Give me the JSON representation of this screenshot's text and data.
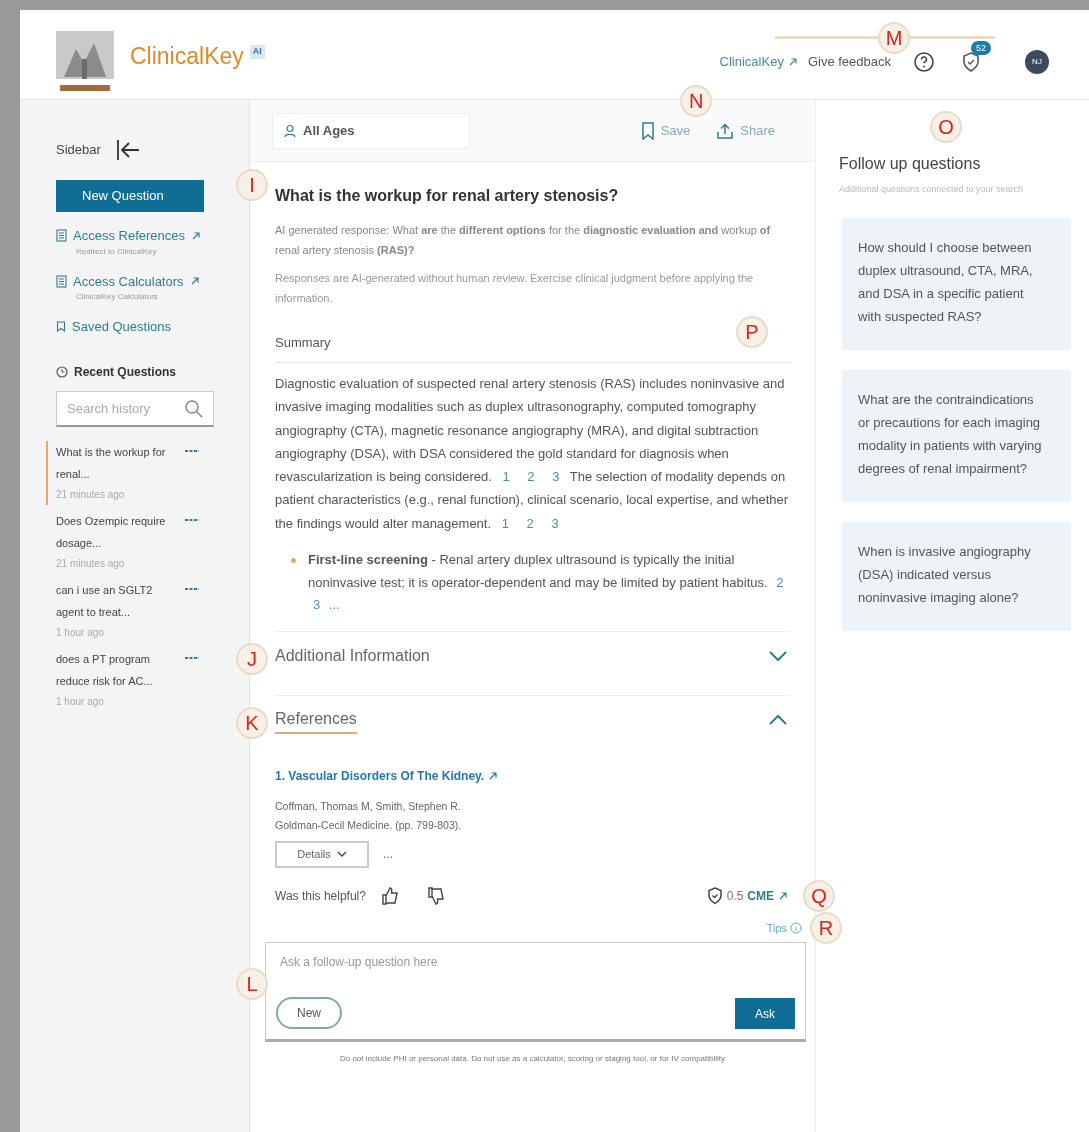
{
  "header": {
    "brand": "ClinicalKey",
    "brand_badge": "AI",
    "links": [
      {
        "label": "ClinicalKey",
        "external": true
      },
      {
        "label": "Give feedback",
        "external": false
      }
    ],
    "notification_count": "52",
    "avatar": "NJ"
  },
  "sidebar": {
    "title": "Sidebar",
    "new_question": "New Question",
    "links": [
      {
        "label": "Access References",
        "sublabel": "Redirect to ClinicalKey",
        "kind": "external"
      },
      {
        "label": "Access Calculators",
        "sublabel": "ClinicalKey Calculators",
        "kind": "external"
      },
      {
        "label": "Saved Questions",
        "kind": "saved"
      }
    ],
    "recent_title": "Recent Questions",
    "search": {
      "placeholder": "Search history"
    },
    "history": [
      {
        "title": "What is the workup for renal...",
        "time": "21 minutes ago",
        "selected": true
      },
      {
        "title": "Does Ozempic require dosage...",
        "time": "21 minutes ago",
        "selected": false
      },
      {
        "title": "can i use an SGLT2 agent to treat...",
        "time": "1 hour ago",
        "selected": false
      },
      {
        "title": "does a PT program reduce risk for AC...",
        "time": "1 hour ago",
        "selected": false
      }
    ]
  },
  "main": {
    "age_filter": "All Ages",
    "actions": [
      {
        "label": "Save",
        "kind": "save"
      },
      {
        "label": "Share",
        "kind": "share"
      }
    ],
    "question": "What is the workup for renal artery stenosis?",
    "ai_response": "AI generated response:  What **are** the **different options** for the **diagnostic evaluation and** workup **of** renal artery stenosis **(RAS)?**",
    "disclaimer": "Responses are AI-generated without human review. Exercise clinical judgment before applying the information.",
    "summary_title": "Summary",
    "summary": [
      {
        "kind": "text",
        "text": "Diagnostic evaluation of suspected renal artery stenosis (RAS) includes noninvasive and invasive imaging modalities such as duplex ultrasonography, computed tomography angiography (CTA), magnetic resonance angiography (MRA), and digital subtraction angiography (DSA), with DSA considered the gold standard for diagnosis when revascularization is being considered."
      },
      {
        "kind": "cite",
        "text": "1"
      },
      {
        "kind": "cite",
        "text": "2"
      },
      {
        "kind": "cite",
        "text": "3"
      },
      {
        "kind": "text",
        "text": "The selection of modality depends on patient characteristics (e.g., renal function), clinical scenario, local expertise, and whether the findings would alter management."
      },
      {
        "kind": "cite",
        "text": "1"
      },
      {
        "kind": "cite",
        "text": "2"
      },
      {
        "kind": "cite",
        "text": "3"
      }
    ],
    "bullets": [
      {
        "text": "**First-line screening** - Renal artery duplex ultrasound is typically the initial noninvasive test; it is operator-dependent and may be limited by patient habitus.",
        "cites": [
          "2",
          "3"
        ],
        "more": "..."
      }
    ],
    "sections": [
      {
        "title": "Additional Information",
        "expanded": false
      },
      {
        "title": "References",
        "expanded": true
      }
    ],
    "reference": {
      "title": "1. Vascular Disorders Of The Kidney.",
      "authors": "Coffman, Thomas M, Smith, Stephen R.",
      "source": "Goldman-Cecil Medicine. (pp. 799-803).",
      "details": "Details",
      "more": "..."
    },
    "helpful": "Was this helpful?",
    "cme": {
      "value": "0.5",
      "label": "CME"
    },
    "tips": "Tips",
    "ask": {
      "placeholder": "Ask a follow-up question here",
      "new": "New",
      "ask": "Ask"
    },
    "footer": "Do not include PHI or personal data. Do not use as a calculator, scoring or staging tool, or for IV compatibility"
  },
  "follow_up": {
    "title": "Follow up questions",
    "subtitle": "Additional questions connected to your search",
    "questions": [
      "How should I choose between duplex ultrasound, CTA, MRA, and DSA in a specific patient with suspected RAS?",
      "What are the contraindications or precautions for each imaging modality in patients with varying degrees of renal impairment?",
      "When is invasive angiography (DSA) indicated versus noninvasive imaging alone?"
    ]
  },
  "annotations": [
    "I",
    "J",
    "K",
    "L",
    "M",
    "N",
    "O",
    "P",
    "Q",
    "R"
  ]
}
